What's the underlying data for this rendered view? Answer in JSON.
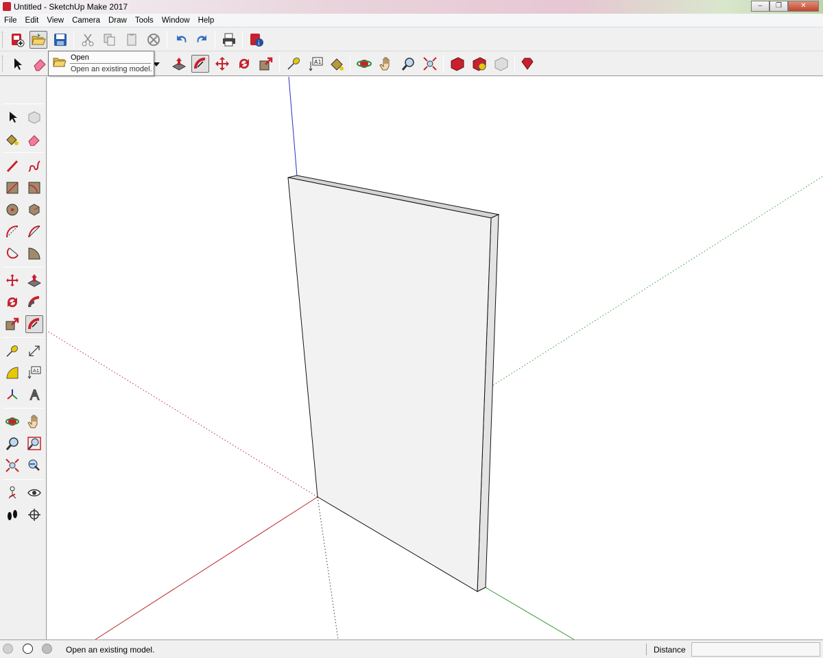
{
  "window": {
    "title": "Untitled - SketchUp Make 2017",
    "controls": {
      "minimize": "–",
      "maximize": "❐",
      "close": "✕"
    }
  },
  "menu": [
    "File",
    "Edit",
    "View",
    "Camera",
    "Draw",
    "Tools",
    "Window",
    "Help"
  ],
  "toolbar_standard": [
    "new-model-icon",
    "open-icon",
    "save-icon",
    "cut-icon",
    "copy-icon",
    "paste-icon",
    "erase-icon",
    "undo-icon",
    "redo-icon",
    "print-icon",
    "model-info-icon"
  ],
  "toolbar_tools": [
    "select-icon",
    "eraser-icon",
    "push-pull-icon",
    "follow-me-icon",
    "move-icon",
    "rotate-icon",
    "scale-icon",
    "tape-measure-icon",
    "text-icon",
    "paint-bucket-icon",
    "orbit-icon",
    "pan-icon",
    "zoom-icon",
    "zoom-extents-icon",
    "get-models-icon",
    "share-model-icon",
    "share-component-icon",
    "extension-warehouse-icon"
  ],
  "tooltip": {
    "title": "Open",
    "description": "Open an existing model."
  },
  "palette": [
    "select-icon",
    "make-component-icon",
    "paint-bucket-icon",
    "eraser-icon",
    "line-icon",
    "freehand-icon",
    "rectangle-icon",
    "rotated-rectangle-icon",
    "circle-icon",
    "polygon-icon",
    "arc-icon",
    "two-point-arc-icon",
    "three-point-arc-icon",
    "pie-icon",
    "move-icon",
    "push-pull-icon",
    "rotate-icon",
    "follow-me-icon",
    "scale-icon",
    "offset-icon",
    "tape-measure-icon",
    "dimension-icon",
    "protractor-icon",
    "text-icon",
    "axes-icon",
    "3d-text-icon",
    "orbit-icon",
    "pan-icon",
    "zoom-icon",
    "zoom-window-icon",
    "zoom-extents-icon",
    "previous-view-icon",
    "position-camera-icon",
    "look-around-icon",
    "walk-icon",
    "section-plane-icon"
  ],
  "status": {
    "message": "Open an existing model.",
    "measurements_label": "Distance",
    "measurements_value": ""
  },
  "colors": {
    "axis_red": "#b8242a",
    "axis_green": "#2f9a2f",
    "axis_blue": "#2a2acb",
    "panel_face": "#f2f2f2",
    "panel_top": "#d7d7d7",
    "panel_side": "#e6e6e6"
  }
}
